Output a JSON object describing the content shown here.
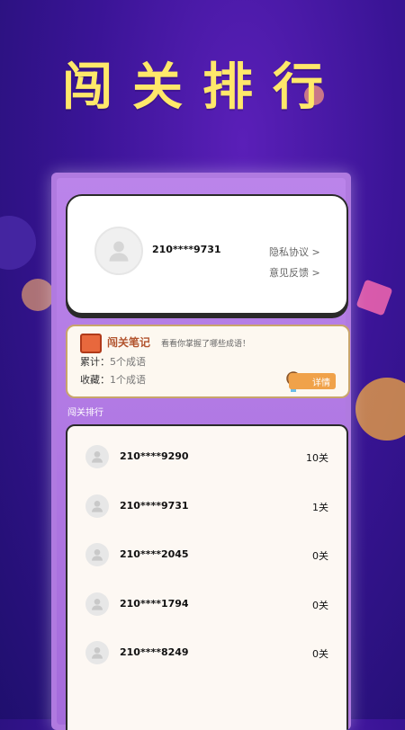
{
  "title": "闯关排行",
  "profile": {
    "phone": "210****9731",
    "privacy_link": "隐私协议 >",
    "feedback_link": "意见反馈 >"
  },
  "notes": {
    "title": "闯关笔记",
    "subtitle": "看看你掌握了哪些成语！",
    "total_label": "累计：",
    "total_value": "5个成语",
    "fav_label": "收藏：",
    "fav_value": "1个成语",
    "detail_button": "详情"
  },
  "rank_section_label": "闯关排行",
  "ranks": [
    {
      "phone": "210****9290",
      "level": "10关"
    },
    {
      "phone": "210****9731",
      "level": "1关"
    },
    {
      "phone": "210****2045",
      "level": "0关"
    },
    {
      "phone": "210****1794",
      "level": "0关"
    },
    {
      "phone": "210****8249",
      "level": "0关"
    }
  ],
  "icons": {
    "avatar": "user-avatar-icon",
    "notebook": "notebook-icon",
    "medal": "medal-icon"
  },
  "colors": {
    "title": "#ffe86a",
    "panel": "#b07ae0",
    "accent": "#f0a24a"
  }
}
